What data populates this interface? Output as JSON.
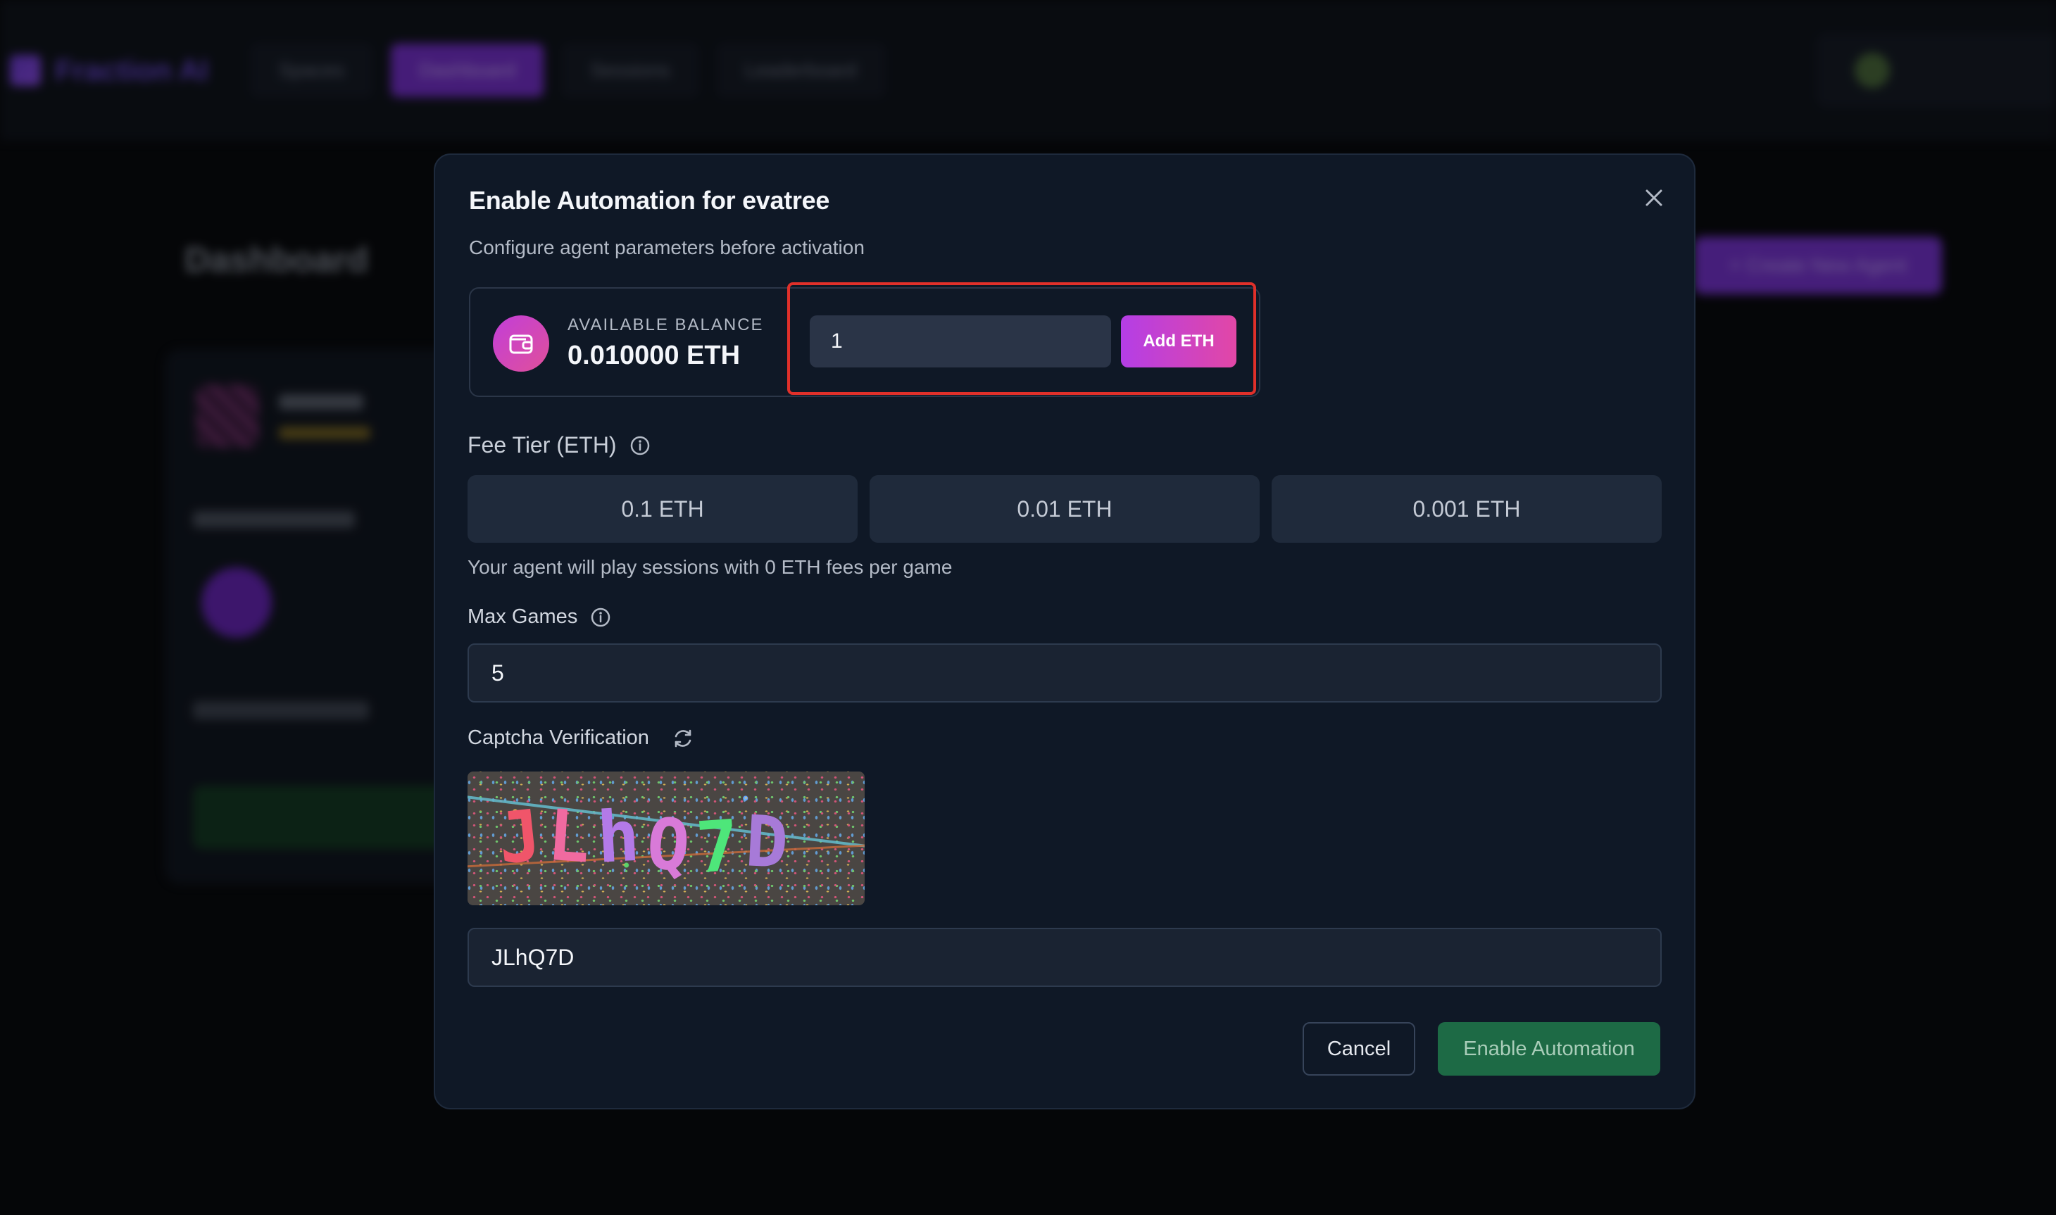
{
  "background": {
    "app_name": "Fraction AI",
    "nav_tabs": [
      {
        "label": "Spaces"
      },
      {
        "label": "Dashboard"
      },
      {
        "label": "Sessions"
      },
      {
        "label": "Leaderboard"
      }
    ],
    "page_title": "Dashboard",
    "create_button_label": "+ Create New Agent",
    "accent_color": "#7a2fd4"
  },
  "modal": {
    "title": "Enable Automation for evatree",
    "subtitle": "Configure agent parameters before activation",
    "balance": {
      "icon": "wallet-icon",
      "label": "AVAILABLE BALANCE",
      "value": "0.010000 ETH"
    },
    "deposit": {
      "amount_value": "1",
      "add_button_label": "Add ETH"
    },
    "fee_tier": {
      "label": "Fee Tier (ETH)",
      "options": [
        "0.1 ETH",
        "0.01 ETH",
        "0.001 ETH"
      ],
      "note": "Your agent will play sessions with 0 ETH fees per game"
    },
    "max_games": {
      "label": "Max Games",
      "value": "5"
    },
    "captcha": {
      "label": "Captcha Verification",
      "image_text": "JLhQ7D",
      "input_value": "JLhQ7D"
    },
    "actions": {
      "cancel_label": "Cancel",
      "enable_label": "Enable Automation"
    },
    "colors": {
      "highlight_frame": "#e0302a",
      "enable_button": "#1d6a45",
      "add_eth_gradient_start": "#b43ee6",
      "add_eth_gradient_end": "#e247a6"
    }
  }
}
